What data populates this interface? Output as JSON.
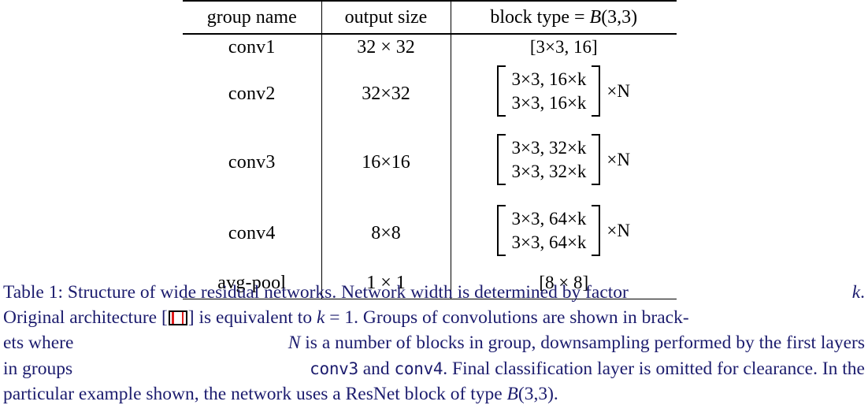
{
  "table": {
    "columns": [
      "group name",
      "output size",
      "block type = B(3,3)"
    ],
    "header": {
      "group_name": "group name",
      "output_size": "output size",
      "block_type_prefix": "block type = ",
      "block_type_var": "B",
      "block_type_args": "(3,3)"
    },
    "rows": [
      {
        "group_name": "conv1",
        "output_size": "32 × 32",
        "block_kind": "single",
        "block_text": "[3×3, 16]",
        "repeat": ""
      },
      {
        "group_name": "conv2",
        "output_size": "32×32",
        "block_kind": "bracket",
        "block_line1": "3×3, 16×k",
        "block_line2": "3×3, 16×k",
        "repeat": "×N"
      },
      {
        "group_name": "conv3",
        "output_size": "16×16",
        "block_kind": "bracket",
        "block_line1": "3×3, 32×k",
        "block_line2": "3×3, 32×k",
        "repeat": "×N"
      },
      {
        "group_name": "conv4",
        "output_size": "8×8",
        "block_kind": "bracket",
        "block_line1": "3×3, 64×k",
        "block_line2": "3×3, 64×k",
        "repeat": "×N"
      },
      {
        "group_name": "avg-pool",
        "output_size": "1 × 1",
        "block_kind": "single",
        "block_text": "[8 × 8]",
        "repeat": ""
      }
    ]
  },
  "caption": {
    "label": "Table 1:",
    "line1_a": "Table 1:  Structure of wide residual networks.  Network width is determined by factor ",
    "line1_k": "k",
    "line1_b": ".",
    "line2_a": "Original architecture [",
    "line2_cite": "redacted-citation",
    "line2_b": "] is equivalent to ",
    "line2_k": "k",
    "line2_c": " = 1. Groups of convolutions are shown in brack-",
    "line3_a": "ets where ",
    "line3_N": "N",
    "line3_b": " is a number of blocks in group, downsampling performed by the first layers",
    "line4_a": "in groups ",
    "line4_mono1": "conv3",
    "line4_b": " and ",
    "line4_mono2": "conv4",
    "line4_c": ". Final classification layer is omitted for clearance.  In the",
    "line5_a": "particular example shown, the network uses a ResNet block of type ",
    "line5_B": "B",
    "line5_b": "(3,3)."
  },
  "colors": {
    "caption_text": "#1c1c6e",
    "table_text": "#000000",
    "rule": "#000000",
    "citation_accent": "#e01b1b",
    "background": "#ffffff"
  }
}
